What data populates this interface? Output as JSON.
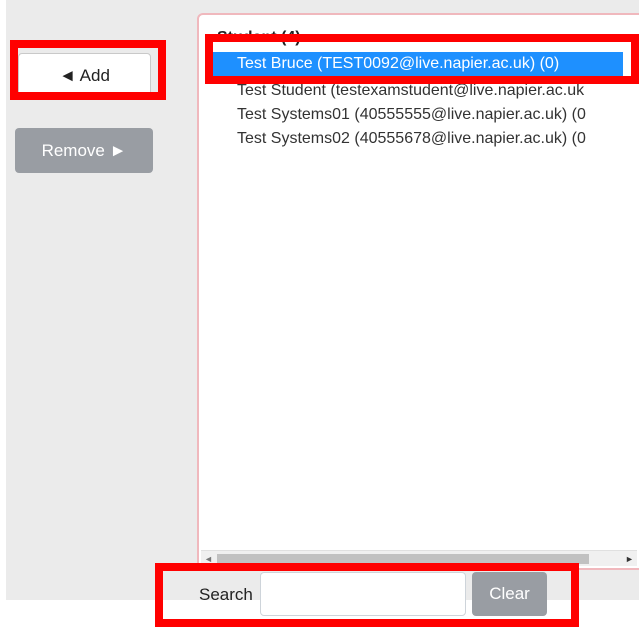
{
  "buttons": {
    "add_label": "◄ Add",
    "remove_label": "Remove ►",
    "clear_label": "Clear"
  },
  "list": {
    "group_label": "Student (4)",
    "options": [
      "Test Bruce (TEST0092@live.napier.ac.uk) (0)",
      "Test Student (testexamstudent@live.napier.ac.uk",
      "Test Systems01 (40555555@live.napier.ac.uk) (0",
      "Test Systems02 (40555678@live.napier.ac.uk) (0"
    ],
    "selected_index": 0
  },
  "search": {
    "label": "Search",
    "value": "",
    "placeholder": ""
  },
  "colors": {
    "selected_bg": "#1e90ff",
    "disabled_button": "#999da3",
    "highlight": "#ff0000",
    "list_border": "#f0b8bd"
  }
}
